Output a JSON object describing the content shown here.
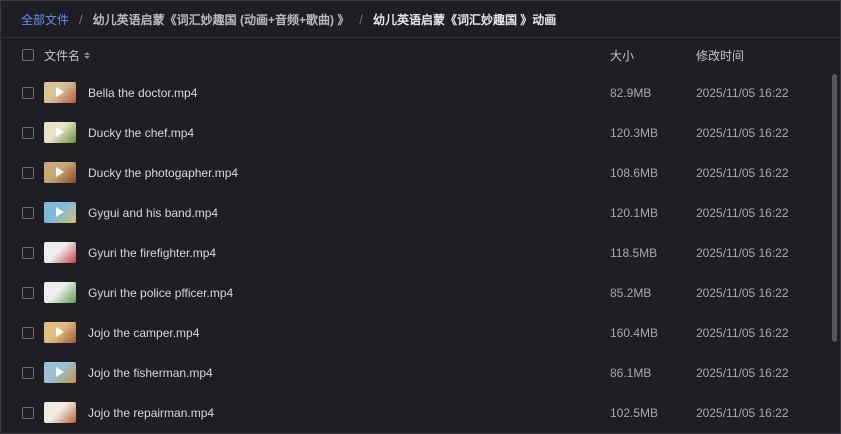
{
  "breadcrumb": {
    "root": "全部文件",
    "middle": "幼儿英语启蒙《词汇妙趣国 (动画+音频+歌曲) 》",
    "current": "幼儿英语启蒙《词汇妙趣国 》动画",
    "separator": "/"
  },
  "table": {
    "columns": {
      "name": "文件名",
      "size": "大小",
      "modified": "修改时间"
    },
    "rows": [
      {
        "name": "Bella the doctor.mp4",
        "size": "82.9MB",
        "modified": "2025/11/05 16:22",
        "thumb_colors": [
          "#d9c49a",
          "#b85a3a"
        ],
        "has_play_icon": true
      },
      {
        "name": "Ducky the chef.mp4",
        "size": "120.3MB",
        "modified": "2025/11/05 16:22",
        "thumb_colors": [
          "#e8e2c8",
          "#6b8f3a"
        ],
        "has_play_icon": true
      },
      {
        "name": "Ducky the photogapher.mp4",
        "size": "108.6MB",
        "modified": "2025/11/05 16:22",
        "thumb_colors": [
          "#c8a878",
          "#8a4a2a"
        ],
        "has_play_icon": true
      },
      {
        "name": "Gygui and his band.mp4",
        "size": "120.1MB",
        "modified": "2025/11/05 16:22",
        "thumb_colors": [
          "#7fb8d8",
          "#d8c070"
        ],
        "has_play_icon": true
      },
      {
        "name": "Gyuri the firefighter.mp4",
        "size": "118.5MB",
        "modified": "2025/11/05 16:22",
        "thumb_colors": [
          "#eeeeee",
          "#c84040"
        ],
        "has_play_icon": false
      },
      {
        "name": "Gyuri the police pfficer.mp4",
        "size": "85.2MB",
        "modified": "2025/11/05 16:22",
        "thumb_colors": [
          "#eeeeee",
          "#5a9a4a"
        ],
        "has_play_icon": false
      },
      {
        "name": "Jojo the camper.mp4",
        "size": "160.4MB",
        "modified": "2025/11/05 16:22",
        "thumb_colors": [
          "#e0c080",
          "#a05a3a"
        ],
        "has_play_icon": true
      },
      {
        "name": "Jojo the fisherman.mp4",
        "size": "86.1MB",
        "modified": "2025/11/05 16:22",
        "thumb_colors": [
          "#9ac0d8",
          "#c89040"
        ],
        "has_play_icon": true
      },
      {
        "name": "Jojo the repairman.mp4",
        "size": "102.5MB",
        "modified": "2025/11/05 16:22",
        "thumb_colors": [
          "#f0ece4",
          "#b8643a"
        ],
        "has_play_icon": false
      }
    ]
  },
  "colors": {
    "background": "#1f1e24",
    "link": "#6e8ef5",
    "text": "#d6d6dc",
    "muted": "#a8a8b0"
  }
}
